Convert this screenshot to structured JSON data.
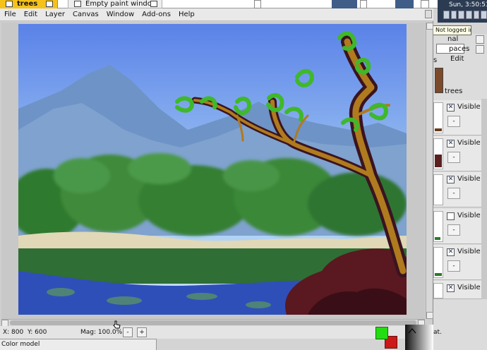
{
  "taskbar": {
    "tabs": [
      {
        "label": "trees",
        "active": true
      },
      {
        "label": "Empty paint window",
        "active": false
      }
    ]
  },
  "clock": "Sun, 3:50:51 AM",
  "login_status": "Not logged in",
  "menu": {
    "items": [
      "File",
      "Edit",
      "Layer",
      "Canvas",
      "Window",
      "Add-ons",
      "Help"
    ]
  },
  "right_panel": {
    "partial_labels": [
      "nal",
      "paces",
      "Edit",
      "s"
    ],
    "layer_group_title": "trees",
    "layers": [
      {
        "visible_label": "Visible",
        "checked": true,
        "mode": "-"
      },
      {
        "visible_label": "Visible",
        "checked": true,
        "mode": "-"
      },
      {
        "visible_label": "Visible",
        "checked": true,
        "mode": "-"
      },
      {
        "visible_label": "Visible",
        "checked": false,
        "mode": "-"
      },
      {
        "visible_label": "Visible",
        "checked": true,
        "mode": "-"
      },
      {
        "visible_label": "Visible",
        "checked": true,
        "mode": "-"
      }
    ]
  },
  "status": {
    "x_label": "X: 800",
    "y_label": "Y: 600",
    "mag_label": "Mag: 100.0%",
    "zoom_out": "-",
    "zoom_in": "+",
    "sat_partial": "at."
  },
  "colors": {
    "foreground": "#22dd11",
    "background": "#cc1818",
    "sky_top": "#5a82e8",
    "tree_trunk": "#b07a1e"
  },
  "bottom_panel": {
    "title": "Color model"
  },
  "icons": {
    "tab": "window-icon",
    "cursor": "hand-cursor-icon",
    "check": "checkmark-icon"
  }
}
